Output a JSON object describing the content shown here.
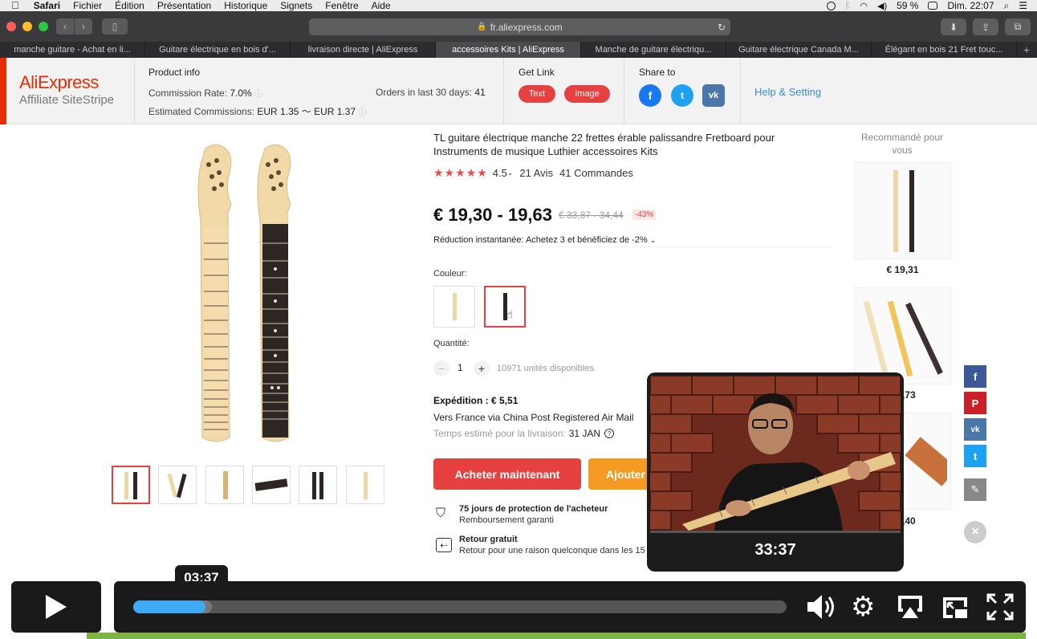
{
  "menubar": {
    "apple": "",
    "app": "Safari",
    "items": [
      "Fichier",
      "Édition",
      "Présentation",
      "Historique",
      "Signets",
      "Fenêtre",
      "Aide"
    ],
    "battery": "59 %",
    "clock": "Dim. 22:07"
  },
  "toolbar": {
    "url": "fr.aliexpress.com"
  },
  "tabs": [
    {
      "label": "manche guitare - Achat en li..."
    },
    {
      "label": "Guitare électrique en bois d'..."
    },
    {
      "label": "livraison directe | AliExpress"
    },
    {
      "label": "accessoires Kits | AliExpress"
    },
    {
      "label": "Manche de guitare électriqu..."
    },
    {
      "label": "Guitare électrique Canada M..."
    },
    {
      "label": "Élégant en bois 21 Fret touc..."
    }
  ],
  "stripe": {
    "logo": "AliExpress",
    "logo_sub": "Affiliate SiteStripe",
    "product_info_title": "Product info",
    "commission_label": "Commission Rate:",
    "commission_value": "7.0%",
    "estimated_label": "Estimated Commissions:",
    "estimated_value": "EUR 1.35 ～ EUR 1.37",
    "orders_label": "Orders in last 30 days:",
    "orders_value": "41",
    "get_link_title": "Get Link",
    "text_btn": "Text",
    "image_btn": "Image",
    "share_title": "Share to",
    "help": "Help & Setting"
  },
  "product": {
    "title": "TL guitare électrique manche 22 frettes érable palissandre Fretboard pour Instruments de musique Luthier accessoires Kits",
    "rating": "4.5",
    "reviews": "21 Avis",
    "orders": "41 Commandes",
    "price": "€ 19,30 - 19,63",
    "old_price": "€ 33,87 - 34,44",
    "discount": "-43%",
    "promo": "Réduction instantanée: Achetez 3 et bénéficiez de -2%",
    "color_label": "Couleur:",
    "qty_label": "Quantité:",
    "qty_value": "1",
    "stock": "10971 unités disponibles",
    "shipping_title": "Expédition : € 5,51",
    "shipping_line": "Vers France via China Post Registered Air Mail",
    "delivery_label": "Temps estimé pour la livraison:",
    "delivery_value": "31 JAN",
    "buy_now": "Acheter maintenant",
    "add_cart": "Ajouter",
    "protect_title": "75 jours de protection de l'acheteur",
    "protect_sub": "Remboursement garanti",
    "return_title": "Retour gratuit",
    "return_sub": "Retour pour une raison quelconque dans les 15 jours"
  },
  "recommend": {
    "title": "Recommandé pour vous",
    "items": [
      {
        "price": "€ 19,31"
      },
      {
        "price": ",73"
      },
      {
        "price": ",40"
      }
    ]
  },
  "pip": {
    "time": "33:37"
  },
  "player": {
    "tooltip_time": "03:37",
    "progress": 0.11,
    "buffered": 0.12
  },
  "colors": {
    "accent": "#e62e04",
    "button_red": "#e64040",
    "cart_orange": "#f59a23",
    "progress_blue": "#3fa9f5"
  }
}
